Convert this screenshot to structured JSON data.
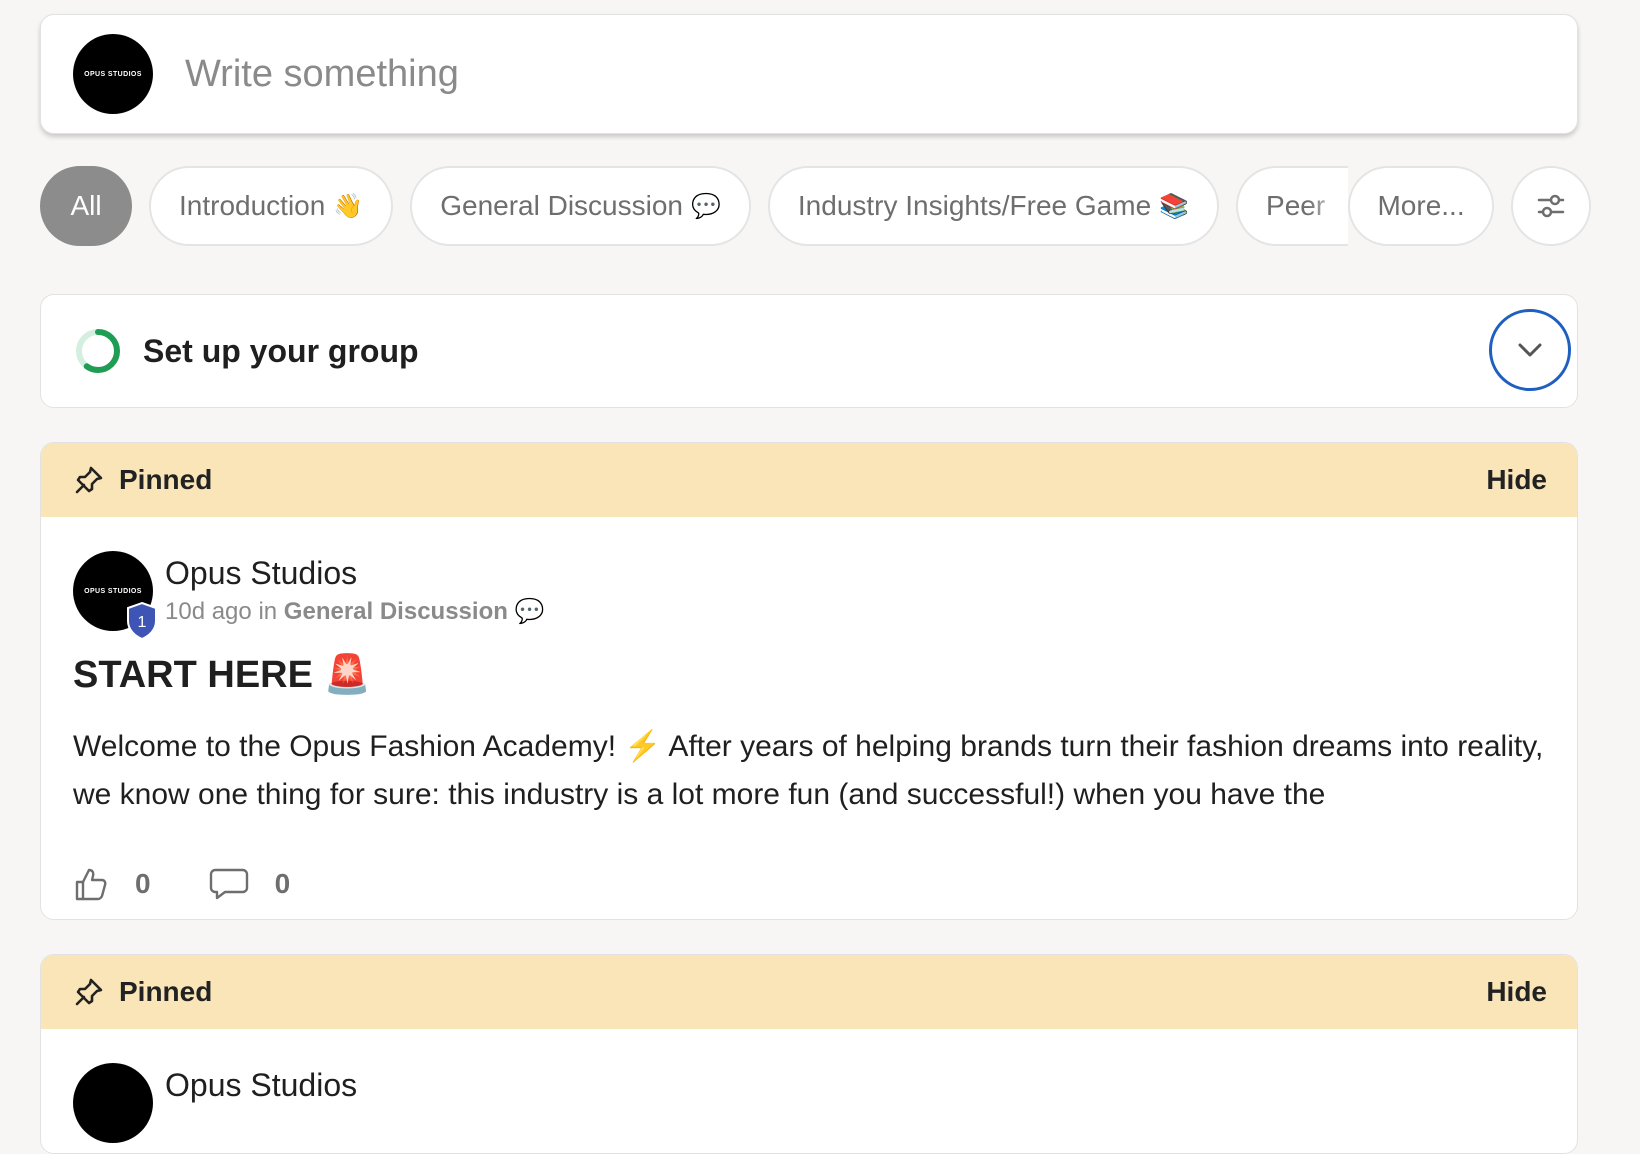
{
  "composer": {
    "avatar_text": "OPUS STUDIOS",
    "placeholder": "Write something"
  },
  "filters": {
    "chips": [
      {
        "label": "All",
        "emoji": ""
      },
      {
        "label": "Introduction",
        "emoji": "👋"
      },
      {
        "label": "General Discussion",
        "emoji": "💬"
      },
      {
        "label": "Industry Insights/Free Game",
        "emoji": "📚"
      },
      {
        "label": "Peer",
        "emoji": ""
      },
      {
        "label": "More...",
        "emoji": ""
      }
    ],
    "filter_icon": "sliders-icon"
  },
  "setup": {
    "title": "Set up your group",
    "progress_fraction": 0.6,
    "accent": "#1f9d55",
    "toggle_icon": "chevron-down-icon"
  },
  "posts": [
    {
      "pinned_label": "Pinned",
      "hide_label": "Hide",
      "author": "Opus Studios",
      "avatar_text": "OPUS STUDIOS",
      "level": "1",
      "time": "10d ago",
      "in_word": "in",
      "category": "General Discussion",
      "category_emoji": "💬",
      "title": "START HERE",
      "title_emoji": "🚨",
      "text_part1": "Welcome to the Opus Fashion Academy! ",
      "text_emoji": "⚡",
      "text_part2": " After years of helping brands turn their fashion dreams into reality, we know one thing for sure: this industry is a lot more fun (and successful!) when you have the",
      "likes": "0",
      "comments": "0"
    },
    {
      "pinned_label": "Pinned",
      "hide_label": "Hide",
      "author": "Opus Studios"
    }
  ],
  "colors": {
    "pinned_bg": "#f9e5b8",
    "page_bg": "#f7f6f4",
    "link_blue": "#1f5fbf",
    "badge_blue": "#3f55b5"
  }
}
